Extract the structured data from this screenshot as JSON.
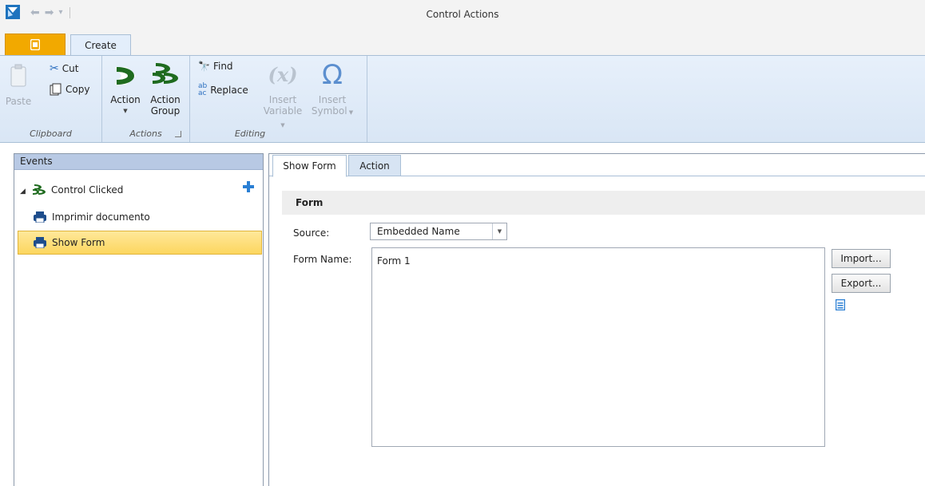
{
  "window": {
    "title": "Control Actions"
  },
  "quick_access": {
    "icons": [
      "undo-icon",
      "redo-icon",
      "customize-icon"
    ]
  },
  "ribbon": {
    "tabs": [
      {
        "label": "",
        "icon": "file-menu-icon"
      },
      {
        "label": "Create"
      }
    ],
    "groups": {
      "clipboard": {
        "label": "Clipboard",
        "paste": "Paste",
        "cut": "Cut",
        "copy": "Copy"
      },
      "actions": {
        "label": "Actions",
        "action": "Action",
        "action_group_line1": "Action",
        "action_group_line2": "Group"
      },
      "editing": {
        "label": "Editing",
        "find": "Find",
        "replace": "Replace",
        "insert_variable_line1": "Insert",
        "insert_variable_line2": "Variable",
        "insert_symbol_line1": "Insert",
        "insert_symbol_line2": "Symbol",
        "variable_glyph": "(x)",
        "symbol_glyph": "Ω"
      }
    }
  },
  "events": {
    "header": "Events",
    "items": [
      {
        "label": "Control Clicked",
        "icon": "action-group-icon",
        "level": 0
      },
      {
        "label": "Imprimir documento",
        "icon": "printer-icon",
        "level": 1
      },
      {
        "label": "Show Form",
        "icon": "printer-icon",
        "level": 1,
        "selected": true
      }
    ]
  },
  "detail": {
    "tabs": [
      {
        "label": "Show Form",
        "active": true
      },
      {
        "label": "Action",
        "active": false
      }
    ],
    "section_title": "Form",
    "source_label": "Source:",
    "source_value": "Embedded Name",
    "form_name_label": "Form Name:",
    "form_name_value": "Form 1",
    "import_button": "Import...",
    "export_button": "Export..."
  },
  "colors": {
    "accent_orange": "#f2a900",
    "ribbon_bg": "#dde8f6",
    "selection": "#fcd65f",
    "action_green": "#1f6b1f",
    "plus_blue": "#2a7fd4"
  }
}
